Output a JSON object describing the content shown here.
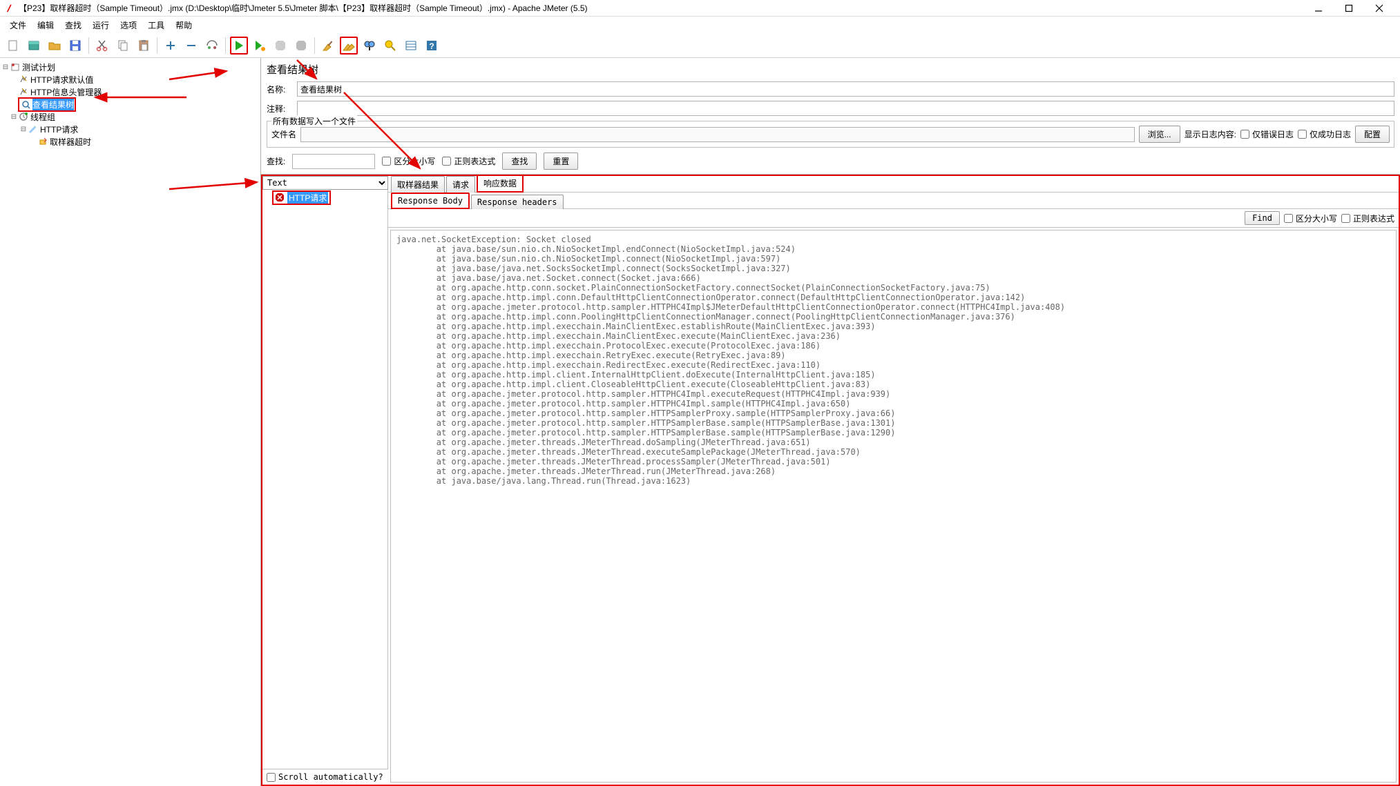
{
  "titlebar": "【P23】取样器超时（Sample Timeout）.jmx (D:\\Desktop\\临时\\Jmeter 5.5\\Jmeter 脚本\\【P23】取样器超时（Sample Timeout）.jmx) - Apache JMeter (5.5)",
  "menu": [
    "文件",
    "编辑",
    "查找",
    "运行",
    "选项",
    "工具",
    "帮助"
  ],
  "tree": {
    "root": "测试计划",
    "items": [
      "HTTP请求默认值",
      "HTTP信息头管理器",
      "查看结果树",
      "线程组"
    ],
    "http_req": "HTTP请求",
    "timeout": "取样器超时"
  },
  "right": {
    "title": "查看结果树",
    "name_label": "名称:",
    "name_value": "查看结果树",
    "comment_label": "注释:",
    "fileset_legend": "所有数据写入一个文件",
    "filename_label": "文件名",
    "browse": "浏览...",
    "log_only": "显示日志内容:",
    "error_only": "仅错误日志",
    "success_only": "仅成功日志",
    "configure": "配置",
    "search_label": "查找:",
    "case_sensitive": "区分大小写",
    "regex": "正则表达式",
    "search_btn": "查找",
    "reset_btn": "重置",
    "renderer": "Text",
    "result_item": "HTTP请求",
    "scroll_auto": "Scroll automatically?",
    "tab1": [
      "取样器结果",
      "请求",
      "响应数据"
    ],
    "tab2": [
      "Response Body",
      "Response headers"
    ],
    "find": "Find",
    "find_case": "区分大小写",
    "find_regex": "正则表达式",
    "body": "java.net.SocketException: Socket closed\n\tat java.base/sun.nio.ch.NioSocketImpl.endConnect(NioSocketImpl.java:524)\n\tat java.base/sun.nio.ch.NioSocketImpl.connect(NioSocketImpl.java:597)\n\tat java.base/java.net.SocksSocketImpl.connect(SocksSocketImpl.java:327)\n\tat java.base/java.net.Socket.connect(Socket.java:666)\n\tat org.apache.http.conn.socket.PlainConnectionSocketFactory.connectSocket(PlainConnectionSocketFactory.java:75)\n\tat org.apache.http.impl.conn.DefaultHttpClientConnectionOperator.connect(DefaultHttpClientConnectionOperator.java:142)\n\tat org.apache.jmeter.protocol.http.sampler.HTTPHC4Impl$JMeterDefaultHttpClientConnectionOperator.connect(HTTPHC4Impl.java:408)\n\tat org.apache.http.impl.conn.PoolingHttpClientConnectionManager.connect(PoolingHttpClientConnectionManager.java:376)\n\tat org.apache.http.impl.execchain.MainClientExec.establishRoute(MainClientExec.java:393)\n\tat org.apache.http.impl.execchain.MainClientExec.execute(MainClientExec.java:236)\n\tat org.apache.http.impl.execchain.ProtocolExec.execute(ProtocolExec.java:186)\n\tat org.apache.http.impl.execchain.RetryExec.execute(RetryExec.java:89)\n\tat org.apache.http.impl.execchain.RedirectExec.execute(RedirectExec.java:110)\n\tat org.apache.http.impl.client.InternalHttpClient.doExecute(InternalHttpClient.java:185)\n\tat org.apache.http.impl.client.CloseableHttpClient.execute(CloseableHttpClient.java:83)\n\tat org.apache.jmeter.protocol.http.sampler.HTTPHC4Impl.executeRequest(HTTPHC4Impl.java:939)\n\tat org.apache.jmeter.protocol.http.sampler.HTTPHC4Impl.sample(HTTPHC4Impl.java:650)\n\tat org.apache.jmeter.protocol.http.sampler.HTTPSamplerProxy.sample(HTTPSamplerProxy.java:66)\n\tat org.apache.jmeter.protocol.http.sampler.HTTPSamplerBase.sample(HTTPSamplerBase.java:1301)\n\tat org.apache.jmeter.protocol.http.sampler.HTTPSamplerBase.sample(HTTPSamplerBase.java:1290)\n\tat org.apache.jmeter.threads.JMeterThread.doSampling(JMeterThread.java:651)\n\tat org.apache.jmeter.threads.JMeterThread.executeSamplePackage(JMeterThread.java:570)\n\tat org.apache.jmeter.threads.JMeterThread.processSampler(JMeterThread.java:501)\n\tat org.apache.jmeter.threads.JMeterThread.run(JMeterThread.java:268)\n\tat java.base/java.lang.Thread.run(Thread.java:1623)"
  }
}
